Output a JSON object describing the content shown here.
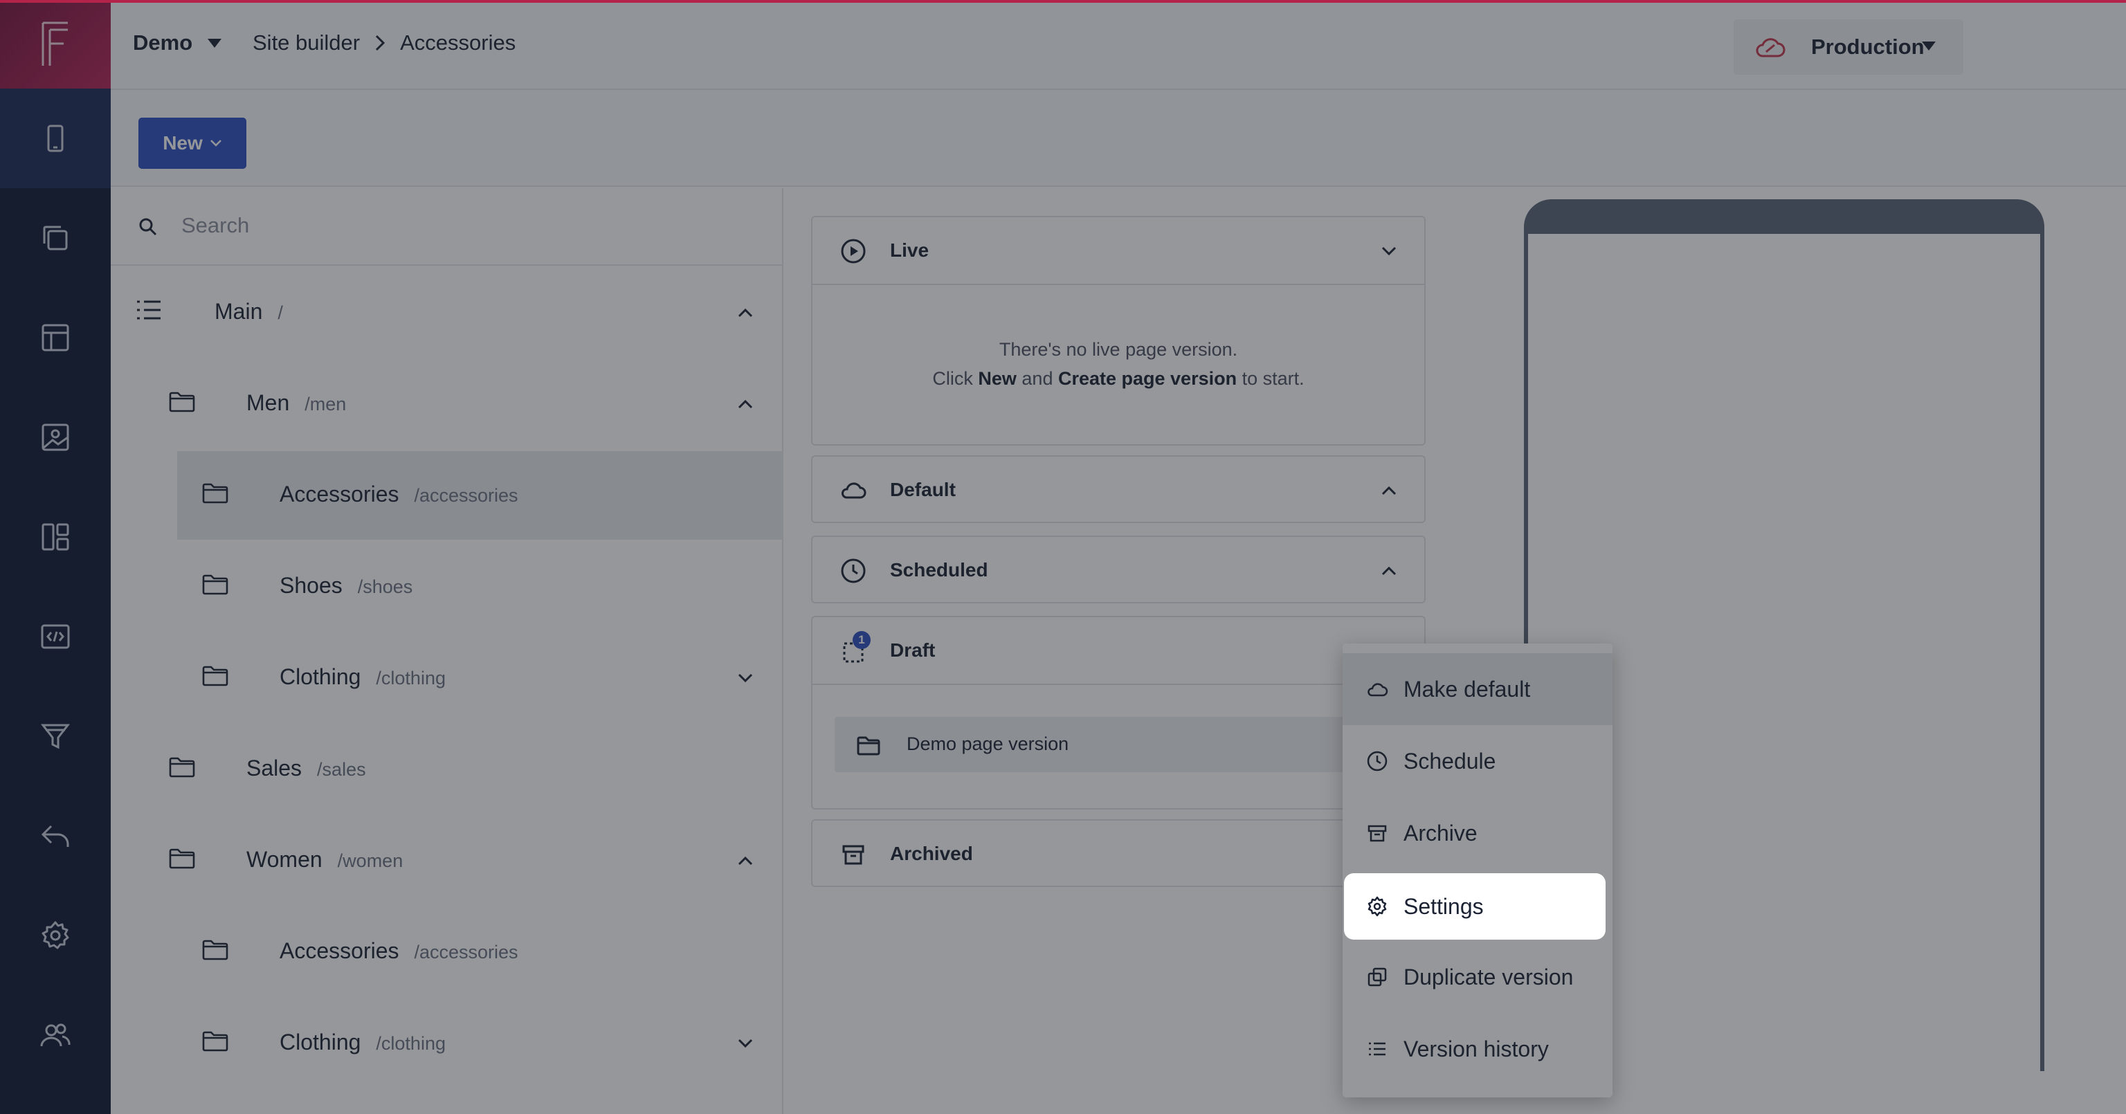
{
  "header": {
    "project": "Demo",
    "breadcrumb": [
      "Site builder",
      "Accessories"
    ],
    "environment": "Production"
  },
  "toolbar": {
    "new_label": "New"
  },
  "rail": {
    "items": [
      "mobile-device-icon",
      "pages-icon",
      "layout-icon",
      "media-icon",
      "dashboard-icon",
      "code-icon",
      "funnel-icon",
      "undo-arrow-icon",
      "gear-icon",
      "users-icon"
    ]
  },
  "tree": {
    "search_placeholder": "Search",
    "nodes": [
      {
        "name": "Main",
        "path": "/",
        "depth": 0,
        "icon": "list-icon",
        "chevron": "up"
      },
      {
        "name": "Men",
        "path": "/men",
        "depth": 1,
        "icon": "folder-icon",
        "chevron": "up"
      },
      {
        "name": "Accessories",
        "path": "/accessories",
        "depth": 2,
        "icon": "folder-icon",
        "selected": true
      },
      {
        "name": "Shoes",
        "path": "/shoes",
        "depth": 2,
        "icon": "folder-icon"
      },
      {
        "name": "Clothing",
        "path": "/clothing",
        "depth": 2,
        "icon": "folder-icon",
        "chevron": "down"
      },
      {
        "name": "Sales",
        "path": "/sales",
        "depth": 1,
        "icon": "folder-icon"
      },
      {
        "name": "Women",
        "path": "/women",
        "depth": 1,
        "icon": "folder-icon",
        "chevron": "up"
      },
      {
        "name": "Accessories",
        "path": "/accessories",
        "depth": 2,
        "icon": "folder-icon"
      },
      {
        "name": "Clothing",
        "path": "/clothing",
        "depth": 2,
        "icon": "folder-icon",
        "chevron": "down"
      }
    ]
  },
  "versions": {
    "live": {
      "title": "Live",
      "empty_line1": "There's no live page version.",
      "empty_line2_prefix": "Click ",
      "empty_line2_new": "New",
      "empty_line2_mid": " and ",
      "empty_line2_create": "Create page version",
      "empty_line2_suffix": " to start."
    },
    "default": {
      "title": "Default"
    },
    "scheduled": {
      "title": "Scheduled"
    },
    "draft": {
      "title": "Draft",
      "badge": "1",
      "item": "Demo page version"
    },
    "archived": {
      "title": "Archived"
    }
  },
  "context_menu": {
    "items": [
      {
        "label": "Make default",
        "icon": "cloud-icon"
      },
      {
        "label": "Schedule",
        "icon": "clock-icon"
      },
      {
        "label": "Archive",
        "icon": "archive-box-icon"
      },
      {
        "label": "Settings",
        "icon": "gear-icon",
        "highlighted": true
      },
      {
        "label": "Duplicate version",
        "icon": "duplicate-icon"
      },
      {
        "label": "Version history",
        "icon": "list-icon"
      }
    ]
  },
  "colors": {
    "rail_bg": "#0f1a36",
    "accent": "#2e4fbf",
    "brand": "#b4234a"
  }
}
